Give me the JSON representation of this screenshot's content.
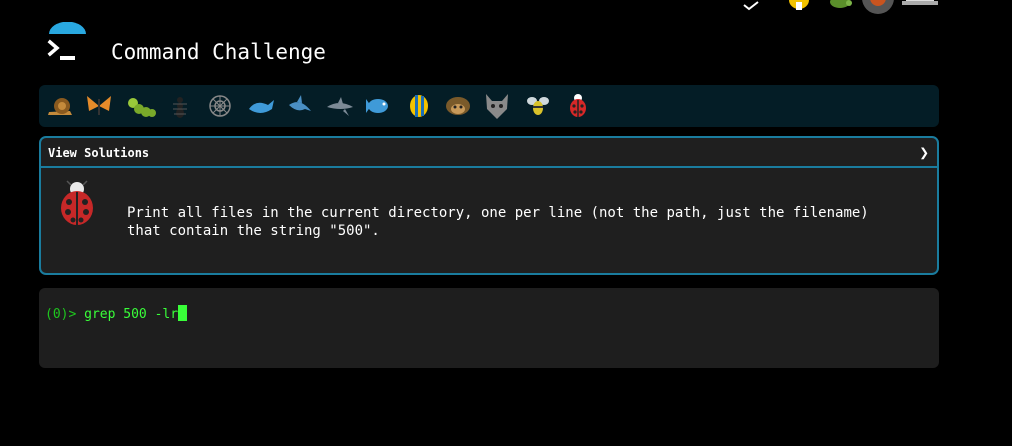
{
  "header": {
    "title": "Command Challenge"
  },
  "creatures": [
    {
      "name": "snail"
    },
    {
      "name": "butterfly"
    },
    {
      "name": "caterpillar"
    },
    {
      "name": "ant"
    },
    {
      "name": "spider-web"
    },
    {
      "name": "whale"
    },
    {
      "name": "shark"
    },
    {
      "name": "dolphin"
    },
    {
      "name": "fish"
    },
    {
      "name": "tropical-fish"
    },
    {
      "name": "hedgehog"
    },
    {
      "name": "wolf"
    },
    {
      "name": "bee"
    },
    {
      "name": "ladybug"
    }
  ],
  "panel": {
    "header_label": "View Solutions",
    "task_text": "Print all files in the current directory, one per line (not the path, just the filename) that contain the string \"500\"."
  },
  "terminal": {
    "prompt": "(0)> ",
    "command": "grep 500 -lr"
  },
  "colors": {
    "accent": "#1a7c9e",
    "prompt_green": "#39ff39",
    "creature_bar_bg": "#041d26"
  }
}
